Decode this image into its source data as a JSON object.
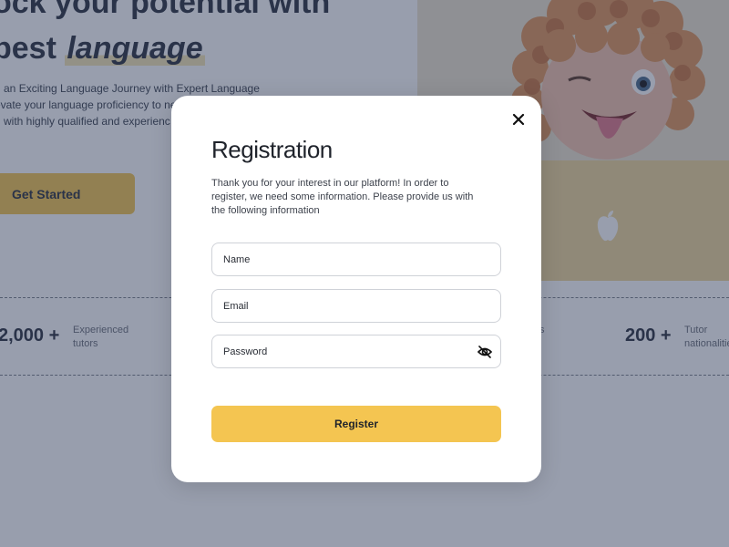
{
  "hero": {
    "title_line1": "ock your potential with",
    "title_line2_prefix": "best ",
    "title_line2_em": "language",
    "description_lines": [
      "n an Exciting Language Journey with Expert Language",
      "evate your language proficiency to ne",
      "g with highly qualified and experienc"
    ],
    "cta_label": "Get Started"
  },
  "stats": [
    {
      "value": "2,000 +",
      "label_lines": [
        "Experienced",
        "tutors"
      ]
    },
    {
      "value": "",
      "label_lines": [
        "s"
      ]
    },
    {
      "value": "200 +",
      "label_lines": [
        "Tutor",
        "nationalities"
      ]
    }
  ],
  "modal": {
    "title": "Registration",
    "description_lines": [
      "Thank you for your interest in our platform! In order to",
      "register, we need some information. Please provide us with",
      "the following information"
    ],
    "fields": {
      "name_placeholder": "Name",
      "email_placeholder": "Email",
      "password_placeholder": "Password"
    },
    "submit_label": "Register"
  },
  "colors": {
    "accent": "#f4c551",
    "overlay": "rgba(40,52,84,0.48)",
    "text_dark": "#1f232b"
  },
  "icons": {
    "close": "close-icon",
    "password_toggle": "eye-off-icon",
    "brand_on_laptop": "apple-logo-icon"
  }
}
